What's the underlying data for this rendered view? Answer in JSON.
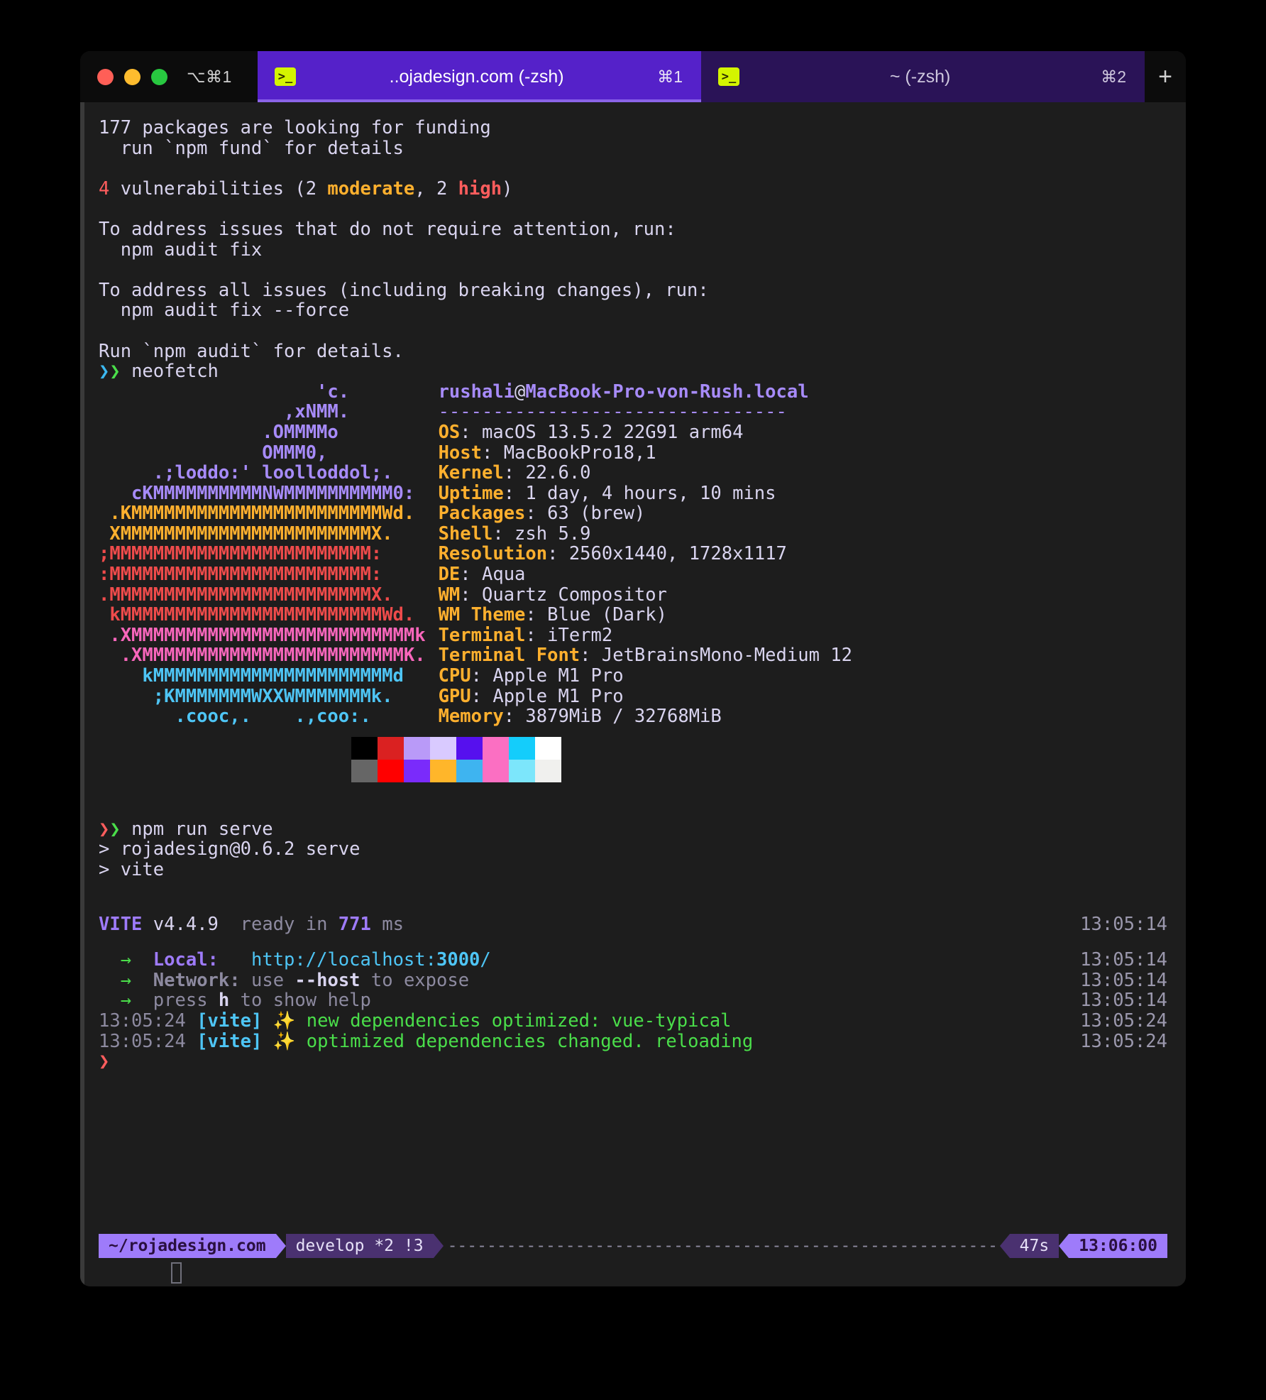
{
  "window": {
    "traffic_lights": [
      "close",
      "minimize",
      "maximize"
    ],
    "shortcut_hint": "⌥⌘1",
    "new_tab_label": "+"
  },
  "tabs": [
    {
      "icon": "terminal-icon",
      "title": "..ojadesign.com (-zsh)",
      "shortcut": "⌘1",
      "active": true
    },
    {
      "icon": "terminal-icon",
      "title": "~ (-zsh)",
      "shortcut": "⌘2",
      "active": false
    }
  ],
  "terminal": {
    "npm_audit": {
      "funding_line": "177 packages are looking for funding",
      "funding_detail": "  run `npm fund` for details",
      "vuln_count": "4",
      "vuln_text": " vulnerabilities (2 ",
      "vuln_moderate": "moderate",
      "vuln_mid": ", 2 ",
      "vuln_high": "high",
      "vuln_close": ")",
      "address_1": "To address issues that do not require attention, run:",
      "address_1_cmd": "  npm audit fix",
      "address_2": "To address all issues (including breaking changes), run:",
      "address_2_cmd": "  npm audit fix --force",
      "run_audit": "Run `npm audit` for details."
    },
    "prompt_symbol": "❯",
    "command_neofetch": "neofetch",
    "command_serve": "npm run serve",
    "neofetch": {
      "user_host": "rushali@MacBook-Pro-von-Rush.local",
      "username": "rushali",
      "at": "@",
      "hostname": "MacBook-Pro-von-Rush.local",
      "separator": "--------------------------------",
      "rows": [
        {
          "label": "OS",
          "value": "macOS 13.5.2 22G91 arm64"
        },
        {
          "label": "Host",
          "value": "MacBookPro18,1"
        },
        {
          "label": "Kernel",
          "value": "22.6.0"
        },
        {
          "label": "Uptime",
          "value": "1 day, 4 hours, 10 mins"
        },
        {
          "label": "Packages",
          "value": "63 (brew)"
        },
        {
          "label": "Shell",
          "value": "zsh 5.9"
        },
        {
          "label": "Resolution",
          "value": "2560x1440, 1728x1117"
        },
        {
          "label": "DE",
          "value": "Aqua"
        },
        {
          "label": "WM",
          "value": "Quartz Compositor"
        },
        {
          "label": "WM Theme",
          "value": "Blue (Dark)"
        },
        {
          "label": "Terminal",
          "value": "iTerm2"
        },
        {
          "label": "Terminal Font",
          "value": "JetBrainsMono-Medium 12"
        },
        {
          "label": "CPU",
          "value": "Apple M1 Pro"
        },
        {
          "label": "GPU",
          "value": "Apple M1 Pro"
        },
        {
          "label": "Memory",
          "value": "3879MiB / 32768MiB"
        }
      ],
      "logo_lines": [
        {
          "text": "                    'c.",
          "color": "#a78bfa"
        },
        {
          "text": "                 ,xNMM.",
          "color": "#a78bfa"
        },
        {
          "text": "               .OMMMMo",
          "color": "#a78bfa"
        },
        {
          "text": "               OMMM0,",
          "color": "#a78bfa"
        },
        {
          "text": "     .;loddo:' loolloddol;.",
          "color": "#a78bfa"
        },
        {
          "text": "   cKMMMMMMMMMMNWMMMMMMMMMM0:",
          "color": "#a78bfa"
        },
        {
          "text": " .KMMMMMMMMMMMMMMMMMMMMMMMWd.",
          "color": "#ffb02e"
        },
        {
          "text": " XMMMMMMMMMMMMMMMMMMMMMMMX.",
          "color": "#ffb02e"
        },
        {
          "text": ";MMMMMMMMMMMMMMMMMMMMMMMM:",
          "color": "#ef4b4b"
        },
        {
          "text": ":MMMMMMMMMMMMMMMMMMMMMMMM:",
          "color": "#ef4b4b"
        },
        {
          "text": ".MMMMMMMMMMMMMMMMMMMMMMMMX.",
          "color": "#ef4b4b"
        },
        {
          "text": " kMMMMMMMMMMMMMMMMMMMMMMMMWd.",
          "color": "#ef4b4b"
        },
        {
          "text": " .XMMMMMMMMMMMMMMMMMMMMMMMMMMk",
          "color": "#f866bb"
        },
        {
          "text": "  .XMMMMMMMMMMMMMMMMMMMMMMMMK.",
          "color": "#f866bb"
        },
        {
          "text": "    kMMMMMMMMMMMMMMMMMMMMMMd",
          "color": "#4ec5f5"
        },
        {
          "text": "     ;KMMMMMMMWXXWMMMMMMMk.",
          "color": "#4ec5f5"
        },
        {
          "text": "       .cooc,.    .,coo:.",
          "color": "#4ec5f5"
        }
      ],
      "palette_row_1": [
        "#000000",
        "#da2121",
        "#b99af8",
        "#d9caff",
        "#5610ee",
        "#fb6fc2",
        "#14cdfb",
        "#ffffff"
      ],
      "palette_row_2": [
        "#666666",
        "#ff0000",
        "#7a2bfb",
        "#ffb62a",
        "#3eb4f0",
        "#fb6fc2",
        "#7ce6fb",
        "#f0f0ee"
      ]
    },
    "npm_serve": {
      "pkg_line": "> rojadesign@0.6.2 serve",
      "bin_line": "> vite"
    },
    "vite": {
      "name": "VITE",
      "version": "v4.4.9",
      "ready_text": "ready in ",
      "ready_ms": "771",
      "ready_unit": " ms",
      "ready_ts": "13:05:14",
      "local_arrow": "→",
      "local_label": "Local:",
      "local_url": "http://localhost:",
      "local_port": "3000",
      "local_url_tail": "/",
      "local_ts": "13:05:14",
      "network_label": "Network:",
      "network_text_a": "use ",
      "network_flag": "--host",
      "network_text_b": " to expose",
      "network_ts": "13:05:14",
      "help_text_a": "press ",
      "help_key": "h",
      "help_text_b": " to show help",
      "help_ts": "13:05:14",
      "log1_time": "13:05:24",
      "log1_tag": "[vite]",
      "log1_sparkle": "✨",
      "log1_msg": "new dependencies optimized: vue-typical",
      "log1_ts": "13:05:24",
      "log2_time": "13:05:24",
      "log2_tag": "[vite]",
      "log2_sparkle": "✨",
      "log2_msg": "optimized dependencies changed. reloading",
      "log2_ts": "13:05:24"
    },
    "statusbar": {
      "path": "~/rojadesign.com",
      "branch": "develop *2 !3",
      "dashes": "--------------------------------------------------------------",
      "duration": "47s",
      "clock": "13:06:00"
    }
  },
  "colors": {
    "tab_active": "#5521c9",
    "tab_inactive": "#2a1357",
    "bg": "#1d1d1d",
    "fg": "#d9d4ef",
    "accent_purple": "#9e7bfa",
    "accent_gold": "#ffb02e",
    "accent_green": "#4ade4a",
    "accent_red": "#ff5d5d"
  }
}
